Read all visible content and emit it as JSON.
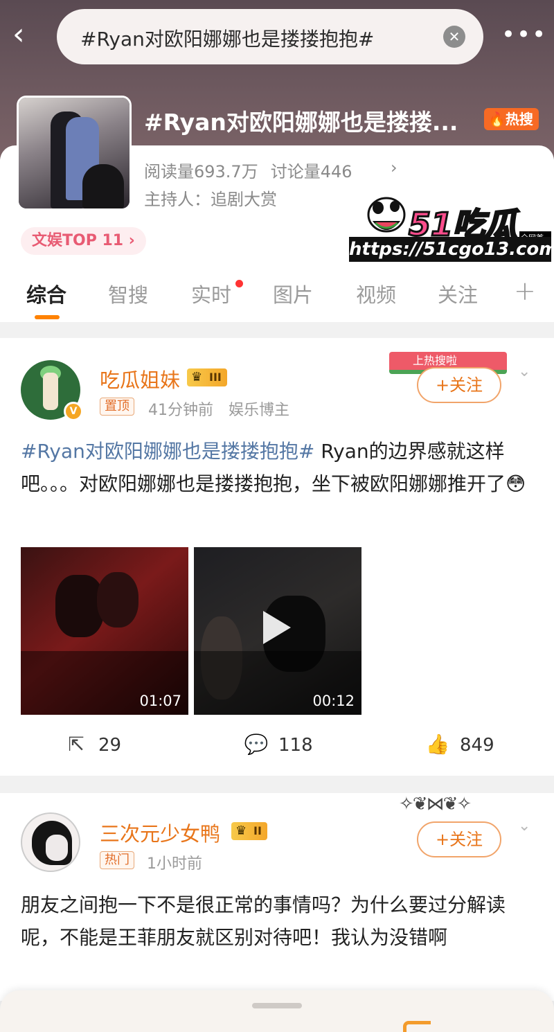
{
  "header": {
    "back_icon": "back-chevron-icon",
    "search_text": "#Ryan对欧阳娜娜也是搂搂抱抱#",
    "clear_icon": "clear-circle-icon",
    "more_icon": "more-dots-icon"
  },
  "topic": {
    "title": "#Ryan对欧阳娜娜也是搂搂...",
    "hot_label": "热搜",
    "reads": "阅读量693.7万",
    "discussions": "讨论量446",
    "arrow": "›",
    "host": "主持人：追剧大赏",
    "rank_chip": "文娱TOP 11 ›"
  },
  "watermark": {
    "brand": "51吃瓜",
    "badge": "全网首发",
    "url": "https://51cgo13.com"
  },
  "tabs": [
    {
      "label": "综合",
      "active": true
    },
    {
      "label": "智搜"
    },
    {
      "label": "实时"
    },
    {
      "label": "图片"
    },
    {
      "label": "视频"
    },
    {
      "label": "关注"
    }
  ],
  "tab_plus": "+",
  "posts": [
    {
      "username": "吃瓜姐妹",
      "level": "III",
      "tag": "置顶",
      "time": "41分钟前",
      "role": "娱乐博主",
      "follow": "+关注",
      "deco_text": "上热搜啦",
      "hashtag": "#Ryan对欧阳娜娜也是搂搂抱抱#",
      "text": " Ryan的边界感就这样吧。。。对欧阳娜娜也是搂搂抱抱，坐下被欧阳娜娜推开了",
      "emoji": "😳",
      "videos": [
        {
          "duration": "01:07"
        },
        {
          "duration": "00:12"
        }
      ],
      "reposts": "29",
      "comments": "118",
      "likes": "849"
    },
    {
      "username": "三次元少女鸭",
      "level": "II",
      "tag": "热门",
      "time": "1小时前",
      "follow": "+关注",
      "text": "朋友之间抱一下不是很正常的事情吗？为什么要过分解读呢，不能是王菲朋友就区别对待吧！我认为没错啊"
    }
  ],
  "colors": {
    "accent": "#ff8200",
    "username": "#e8751a",
    "hashtag": "#5477a4",
    "hot": "#f76a24"
  }
}
